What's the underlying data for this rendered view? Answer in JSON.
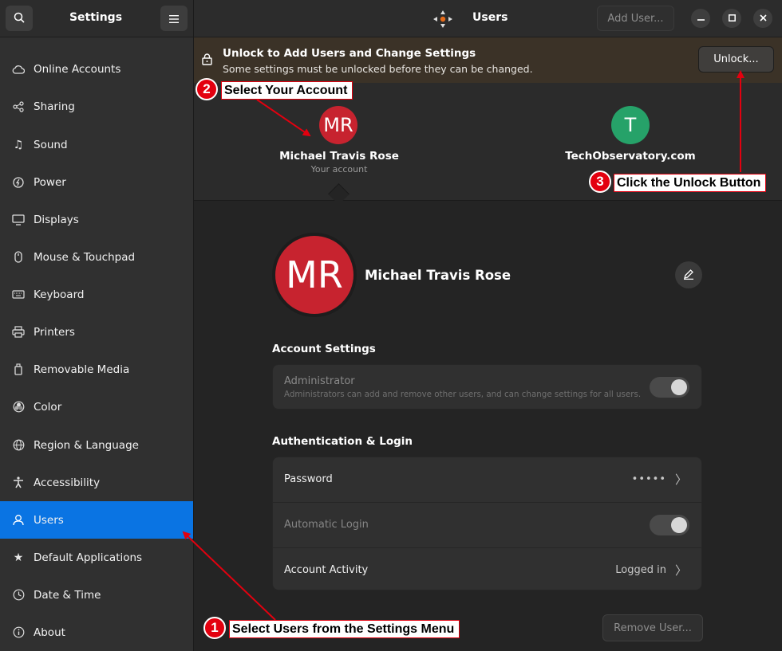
{
  "sidebar": {
    "title": "Settings",
    "items": [
      {
        "label": "Online Accounts",
        "icon": "cloud-icon"
      },
      {
        "label": "Sharing",
        "icon": "share-icon"
      },
      {
        "label": "Sound",
        "icon": "music-note-icon"
      },
      {
        "label": "Power",
        "icon": "power-icon"
      },
      {
        "label": "Displays",
        "icon": "display-icon"
      },
      {
        "label": "Mouse & Touchpad",
        "icon": "mouse-icon"
      },
      {
        "label": "Keyboard",
        "icon": "keyboard-icon"
      },
      {
        "label": "Printers",
        "icon": "printer-icon"
      },
      {
        "label": "Removable Media",
        "icon": "usb-drive-icon"
      },
      {
        "label": "Color",
        "icon": "color-icon"
      },
      {
        "label": "Region & Language",
        "icon": "globe-icon"
      },
      {
        "label": "Accessibility",
        "icon": "accessibility-icon"
      },
      {
        "label": "Users",
        "icon": "users-icon"
      },
      {
        "label": "Default Applications",
        "icon": "star-icon"
      },
      {
        "label": "Date & Time",
        "icon": "clock-icon"
      },
      {
        "label": "About",
        "icon": "info-icon"
      }
    ],
    "active_item": "Users"
  },
  "header": {
    "title": "Users",
    "add_user_label": "Add User..."
  },
  "banner": {
    "title": "Unlock to Add Users and Change Settings",
    "subtitle": "Some settings must be unlocked before they can be changed.",
    "unlock_label": "Unlock..."
  },
  "carousel": {
    "users": [
      {
        "initials": "MR",
        "name": "Michael Travis Rose",
        "subtitle": "Your account",
        "color": "#c7232f"
      },
      {
        "initials": "T",
        "name": "TechObservatory.com",
        "subtitle": "",
        "color": "#26a269"
      }
    ]
  },
  "profile": {
    "initials": "MR",
    "full_name": "Michael Travis Rose"
  },
  "account_settings": {
    "title": "Account Settings",
    "administrator_label": "Administrator",
    "administrator_desc": "Administrators can add and remove other users, and can change settings for all users.",
    "administrator_on": true
  },
  "auth": {
    "title": "Authentication & Login",
    "password_label": "Password",
    "password_value": "•••••",
    "auto_login_label": "Automatic Login",
    "auto_login_on": true,
    "activity_label": "Account Activity",
    "activity_value": "Logged in"
  },
  "remove_user_label": "Remove User...",
  "annotations": [
    {
      "number": "1",
      "text": "Select Users from the Settings Menu"
    },
    {
      "number": "2",
      "text": "Select Your Account"
    },
    {
      "number": "3",
      "text": "Click the Unlock Button"
    }
  ],
  "colors": {
    "accent": "#0a74e3",
    "annotation_red": "#e3000f",
    "banner_bg": "#3b3227"
  }
}
